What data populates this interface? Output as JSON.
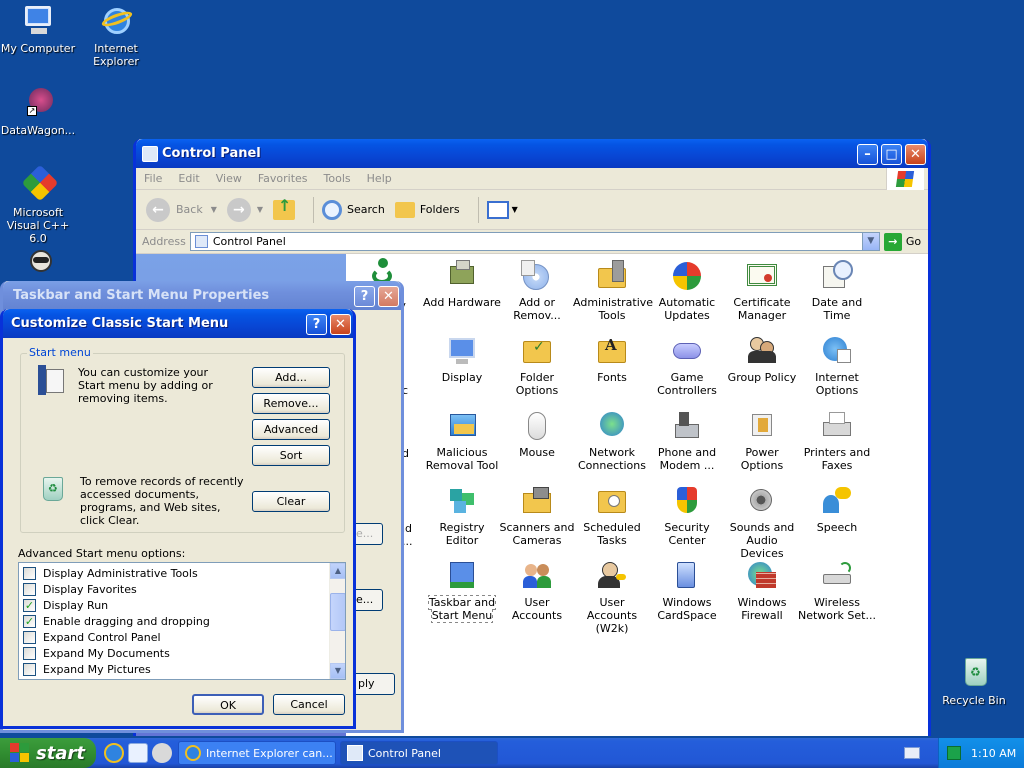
{
  "desktop": {
    "icons": [
      {
        "label": "My Computer"
      },
      {
        "label": "Internet Explorer"
      },
      {
        "label": "DataWagon..."
      },
      {
        "label": "Microsoft Visual C++ 6.0"
      },
      {
        "label": "Recycle Bin"
      }
    ]
  },
  "control_panel": {
    "title": "Control Panel",
    "menu": [
      "File",
      "Edit",
      "View",
      "Favorites",
      "Tools",
      "Help"
    ],
    "toolbar": {
      "back": "Back",
      "search": "Search",
      "folders": "Folders"
    },
    "address": {
      "label": "Address",
      "value": "Control Panel",
      "go": "Go"
    },
    "partial_labels": [
      "ty",
      "c",
      "d",
      "nd",
      "..."
    ],
    "icons": [
      {
        "label": "Add Hardware"
      },
      {
        "label": "Add or Remov..."
      },
      {
        "label": "Administrative Tools"
      },
      {
        "label": "Automatic Updates"
      },
      {
        "label": "Certificate Manager"
      },
      {
        "label": "Date and Time"
      },
      {
        "label": "Display"
      },
      {
        "label": "Folder Options"
      },
      {
        "label": "Fonts"
      },
      {
        "label": "Game Controllers"
      },
      {
        "label": "Group Policy"
      },
      {
        "label": "Internet Options"
      },
      {
        "label": "Malicious Removal Tool"
      },
      {
        "label": "Mouse"
      },
      {
        "label": "Network Connections"
      },
      {
        "label": "Phone and Modem ..."
      },
      {
        "label": "Power Options"
      },
      {
        "label": "Printers and Faxes"
      },
      {
        "label": "Registry Editor"
      },
      {
        "label": "Scanners and Cameras"
      },
      {
        "label": "Scheduled Tasks"
      },
      {
        "label": "Security Center"
      },
      {
        "label": "Sounds and Audio Devices"
      },
      {
        "label": "Speech"
      },
      {
        "label": "Taskbar and Start Menu"
      },
      {
        "label": "User Accounts"
      },
      {
        "label": "User Accounts (W2k)"
      },
      {
        "label": "Windows CardSpace"
      },
      {
        "label": "Windows Firewall"
      },
      {
        "label": "Wireless Network Set..."
      }
    ]
  },
  "taskbar_props": {
    "title": "Taskbar and Start Menu Properties",
    "apply_partial": "ply",
    "btn_partial_1": "e...",
    "btn_partial_2": "e..."
  },
  "customize": {
    "title": "Customize Classic Start Menu",
    "group_title": "Start menu",
    "intro_text": "You can customize your Start menu by adding or removing items.",
    "clear_text": "To remove records of recently accessed documents, programs, and Web sites, click Clear.",
    "buttons": {
      "add": "Add...",
      "remove": "Remove...",
      "advanced": "Advanced",
      "sort": "Sort",
      "clear": "Clear",
      "ok": "OK",
      "cancel": "Cancel"
    },
    "options_label": "Advanced Start menu options:",
    "options": [
      {
        "label": "Display Administrative Tools",
        "checked": false
      },
      {
        "label": "Display Favorites",
        "checked": false
      },
      {
        "label": "Display Run",
        "checked": true
      },
      {
        "label": "Enable dragging and dropping",
        "checked": true
      },
      {
        "label": "Expand Control Panel",
        "checked": false
      },
      {
        "label": "Expand My Documents",
        "checked": false
      },
      {
        "label": "Expand My Pictures",
        "checked": false
      }
    ]
  },
  "taskbar": {
    "start_label": "start",
    "tasks": [
      {
        "label": "Internet Explorer can..."
      },
      {
        "label": "Control Panel"
      }
    ],
    "clock": "1:10 AM"
  },
  "colors": {
    "desktop": "#0f4a9c",
    "title_active": "#0846d4",
    "start_green": "#2f8a2f"
  }
}
